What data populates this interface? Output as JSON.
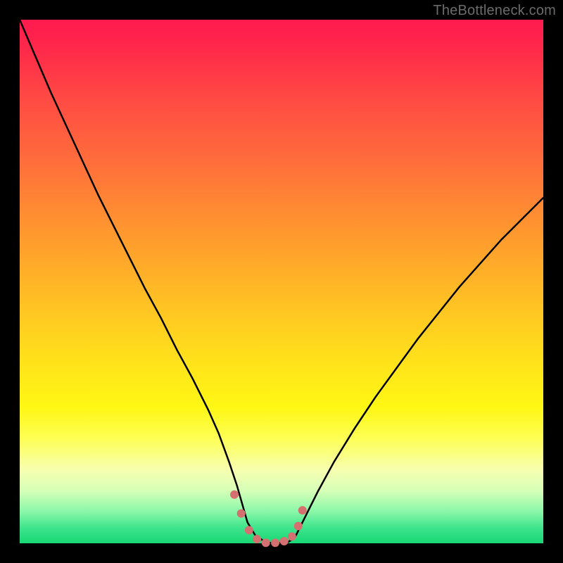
{
  "watermark": "TheBottleneck.com",
  "chart_data": {
    "type": "line",
    "title": "",
    "xlabel": "",
    "ylabel": "",
    "xlim": [
      0,
      100
    ],
    "ylim": [
      0,
      100
    ],
    "grid": false,
    "legend": false,
    "series": [
      {
        "name": "curve",
        "stroke": "#000000",
        "stroke_width": 2.5,
        "x": [
          0.0,
          3,
          6,
          9,
          12,
          15,
          18,
          21,
          24,
          27,
          30,
          33,
          36,
          38,
          40,
          41.5,
          42.5,
          43.5,
          45,
          47,
          49,
          51,
          52.5,
          53.5,
          55,
          57,
          60,
          64,
          68,
          72,
          76,
          80,
          84,
          88,
          92,
          96,
          100
        ],
        "y": [
          100,
          93,
          86,
          79.5,
          73,
          66.5,
          60.5,
          54.5,
          48.5,
          43,
          37,
          31.5,
          25.5,
          21,
          15.5,
          11,
          7.5,
          4,
          1.5,
          0.2,
          0,
          0.1,
          1,
          3,
          6,
          10,
          15.5,
          22,
          28,
          33.5,
          39,
          44,
          49,
          53.5,
          58,
          62,
          66
        ]
      },
      {
        "name": "valley-dots",
        "stroke": "#d4706f",
        "marker": "circle",
        "marker_radius": 6,
        "x": [
          41.0,
          42.3,
          43.8,
          45.3,
          47.0,
          48.8,
          50.5,
          52.0,
          53.2,
          54.0
        ],
        "y": [
          9.3,
          5.7,
          2.5,
          0.8,
          0.1,
          0.1,
          0.4,
          1.3,
          3.3,
          6.3
        ]
      }
    ]
  }
}
